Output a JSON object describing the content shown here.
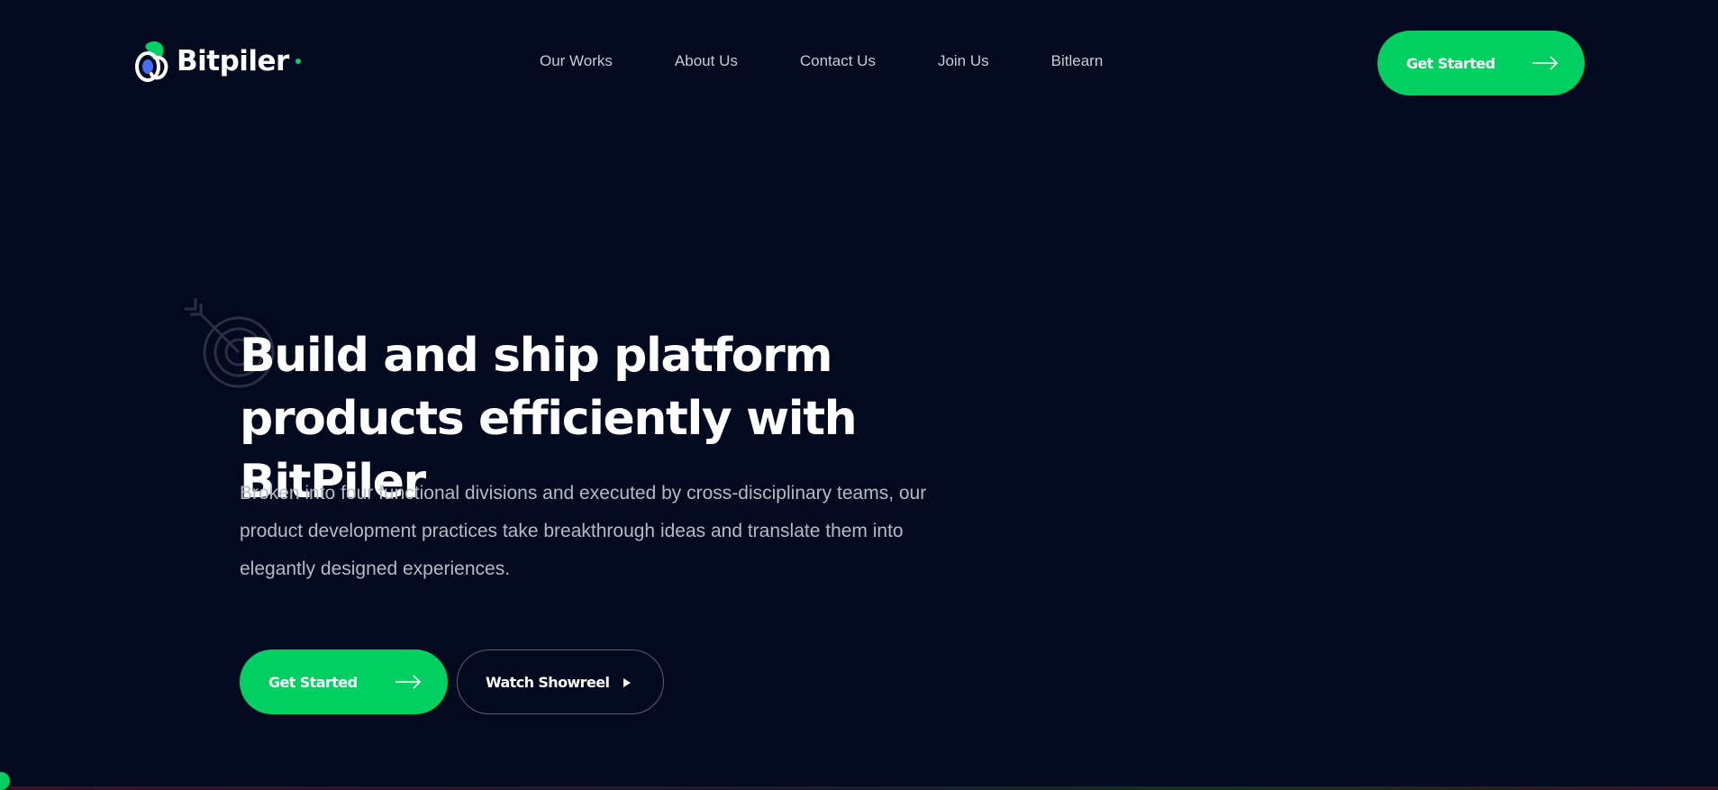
{
  "brand": {
    "name": "Bitpiler",
    "accent_color": "#00d061",
    "background_color": "#010a1f"
  },
  "header": {
    "nav": [
      {
        "label": "Our Works"
      },
      {
        "label": "About Us"
      },
      {
        "label": "Contact Us"
      },
      {
        "label": "Join Us"
      },
      {
        "label": "Bitlearn"
      }
    ],
    "cta": {
      "label": "Get Started",
      "icon": "arrow-right-icon"
    }
  },
  "hero": {
    "decoration_icon": "target-arrow-icon",
    "title": "Build and ship platform products efficiently with BitPiler",
    "description": "Broken into four functional divisions and executed by cross-disciplinary teams, our product development practices take breakthrough ideas and translate them into elegantly designed experiences.",
    "primary_cta": {
      "label": "Get Started",
      "icon": "arrow-right-icon"
    },
    "secondary_cta": {
      "label": "Watch Showreel",
      "icon": "play-icon"
    }
  }
}
